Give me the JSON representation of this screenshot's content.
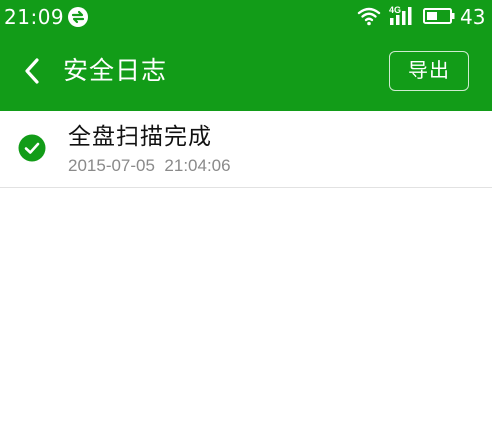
{
  "status_bar": {
    "time": "21:09",
    "network_label": "4G",
    "battery": "43"
  },
  "header": {
    "title": "安全日志",
    "export_label": "导出"
  },
  "log": {
    "items": [
      {
        "title": "全盘扫描完成",
        "date": "2015-07-05",
        "time": "21:04:06",
        "datetime": "2015-07-05  21:04:06",
        "status": "success"
      }
    ]
  },
  "colors": {
    "primary": "#129c18",
    "check": "#129c18",
    "divider": "#e2e2e2",
    "subtext": "#8a8a8a"
  },
  "icons": {
    "sync": "sync-icon",
    "wifi": "wifi-icon",
    "signal": "signal-icon",
    "battery": "battery-icon",
    "back": "back-chevron-icon",
    "status": "check-circle-icon"
  }
}
